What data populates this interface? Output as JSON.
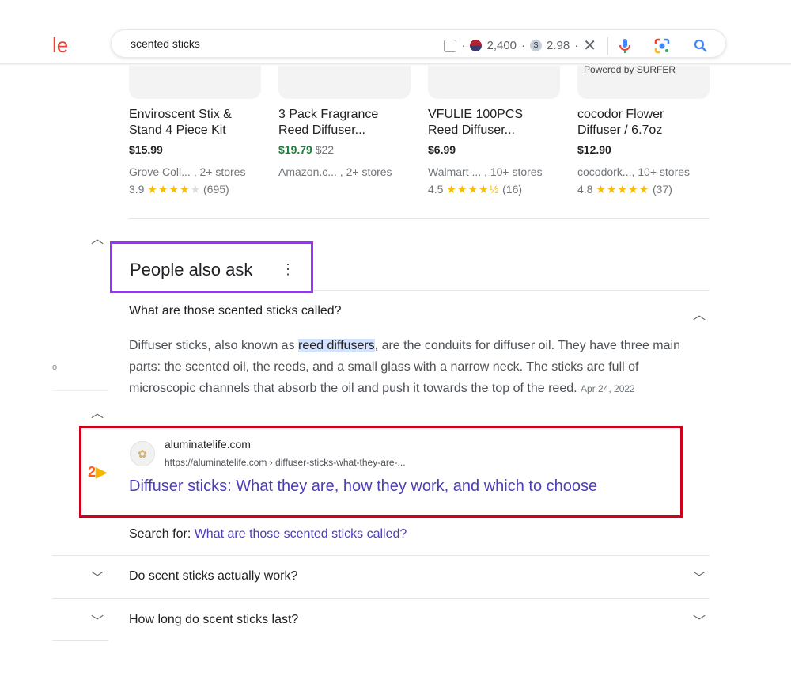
{
  "header": {
    "logo_fragment": "le",
    "query": "scented sticks",
    "volume": "2,400",
    "cpc": "2.98",
    "dot": "·"
  },
  "products": [
    {
      "title_line1": "Enviroscent Stix &",
      "title_line2": "Stand 4 Piece Kit",
      "price": "$15.99",
      "old_price": "",
      "stores": "Grove Coll... , 2+ stores",
      "rating": "3.9",
      "stars": "★★★★",
      "empty_stars": "★",
      "reviews": "(695)",
      "sale": false
    },
    {
      "title_line1": "3 Pack Fragrance",
      "title_line2": "Reed Diffuser...",
      "price": "$19.79",
      "old_price": "$22",
      "stores": "Amazon.c... , 2+ stores",
      "rating": "",
      "stars": "",
      "empty_stars": "",
      "reviews": "",
      "sale": true
    },
    {
      "title_line1": "VFULIE 100PCS",
      "title_line2": "Reed Diffuser...",
      "price": "$6.99",
      "old_price": "",
      "stores": "Walmart ... , 10+ stores",
      "rating": "4.5",
      "stars": "★★★★½",
      "empty_stars": "",
      "reviews": "(16)",
      "sale": false
    },
    {
      "title_line1": "cocodor Flower",
      "title_line2": "Diffuser / 6.7oz",
      "price": "$12.90",
      "old_price": "",
      "stores": "cocodork..., 10+ stores",
      "rating": "4.8",
      "stars": "★★★★★",
      "empty_stars": "",
      "reviews": "(37)",
      "sale": false
    }
  ],
  "powered_by": "Powered by SURFER",
  "paa": {
    "title": "People also ask",
    "q1": "What are those scented sticks called?",
    "answer_pre": "Diffuser sticks, also known as ",
    "answer_hl": "reed diffusers",
    "answer_post": ", are the conduits for diffuser oil. They have three main parts: the scented oil, the reeds, and a small glass with a narrow neck. The sticks are full of microscopic channels that absorb the oil and push it towards the top of the reed.",
    "date": "Apr 24, 2022",
    "source_domain": "aluminatelife.com",
    "source_url": "https://aluminatelife.com › diffuser-sticks-what-they-are-...",
    "marker": "2",
    "result_title": "Diffuser sticks: What they are, how they work, and which to choose",
    "search_for_label": "Search for: ",
    "search_for_link": "What are those scented sticks called?",
    "q2": "Do scent sticks actually work?",
    "q3": "How long do scent sticks last?"
  },
  "left_fragment": "o",
  "colors": {
    "highlight_box": "#9b30ff",
    "result_box": "#d0021b",
    "link": "#4c3fb5",
    "sale": "#188038",
    "stars": "#fbbc04"
  }
}
